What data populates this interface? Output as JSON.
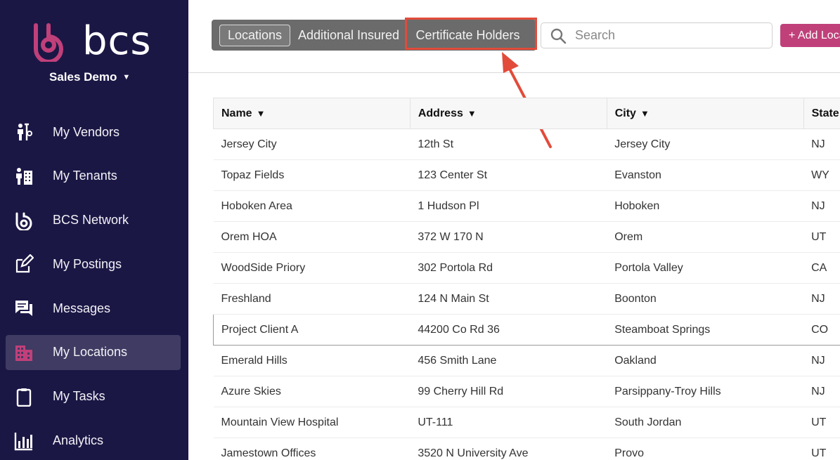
{
  "sidebar": {
    "logo_text": "bcs",
    "account_name": "Sales Demo",
    "brand_color": "#c0407a",
    "items": [
      {
        "label": "My Vendors",
        "icon": "vendors-icon"
      },
      {
        "label": "My Tenants",
        "icon": "tenants-icon"
      },
      {
        "label": "BCS Network",
        "icon": "bcs-network-icon"
      },
      {
        "label": "My Postings",
        "icon": "postings-icon"
      },
      {
        "label": "Messages",
        "icon": "messages-icon"
      },
      {
        "label": "My Locations",
        "icon": "locations-icon",
        "active": true
      },
      {
        "label": "My Tasks",
        "icon": "tasks-icon"
      },
      {
        "label": "Analytics",
        "icon": "analytics-icon"
      }
    ]
  },
  "toolbar": {
    "tabs": [
      {
        "label": "Locations",
        "active": true
      },
      {
        "label": "Additional Insured"
      },
      {
        "label": "Certificate Holders",
        "highlighted": true
      }
    ],
    "search_placeholder": "Search",
    "add_label": "+ Add Location",
    "annotation_color": "#e24b3a"
  },
  "table": {
    "columns": [
      "Name",
      "Address",
      "City",
      "State"
    ],
    "rows": [
      [
        "Jersey City",
        "12th St",
        "Jersey City",
        "NJ"
      ],
      [
        "Topaz Fields",
        "123 Center St",
        "Evanston",
        "WY"
      ],
      [
        "Hoboken Area",
        "1 Hudson Pl",
        "Hoboken",
        "NJ"
      ],
      [
        "Orem HOA",
        "372 W 170 N",
        "Orem",
        "UT"
      ],
      [
        "WoodSide Priory",
        "302 Portola Rd",
        "Portola Valley",
        "CA"
      ],
      [
        "Freshland",
        "124 N Main St",
        "Boonton",
        "NJ"
      ],
      [
        "Project Client A",
        "44200 Co Rd 36",
        "Steamboat Springs",
        "CO"
      ],
      [
        "Emerald Hills",
        "456 Smith Lane",
        "Oakland",
        "NJ"
      ],
      [
        "Azure Skies",
        "99 Cherry Hill Rd",
        "Parsippany-Troy Hills",
        "NJ"
      ],
      [
        "Mountain View Hospital",
        "UT-111",
        "South Jordan",
        "UT"
      ],
      [
        "Jamestown Offices",
        "3520 N University Ave",
        "Provo",
        "UT"
      ]
    ],
    "selected_row": 6
  }
}
